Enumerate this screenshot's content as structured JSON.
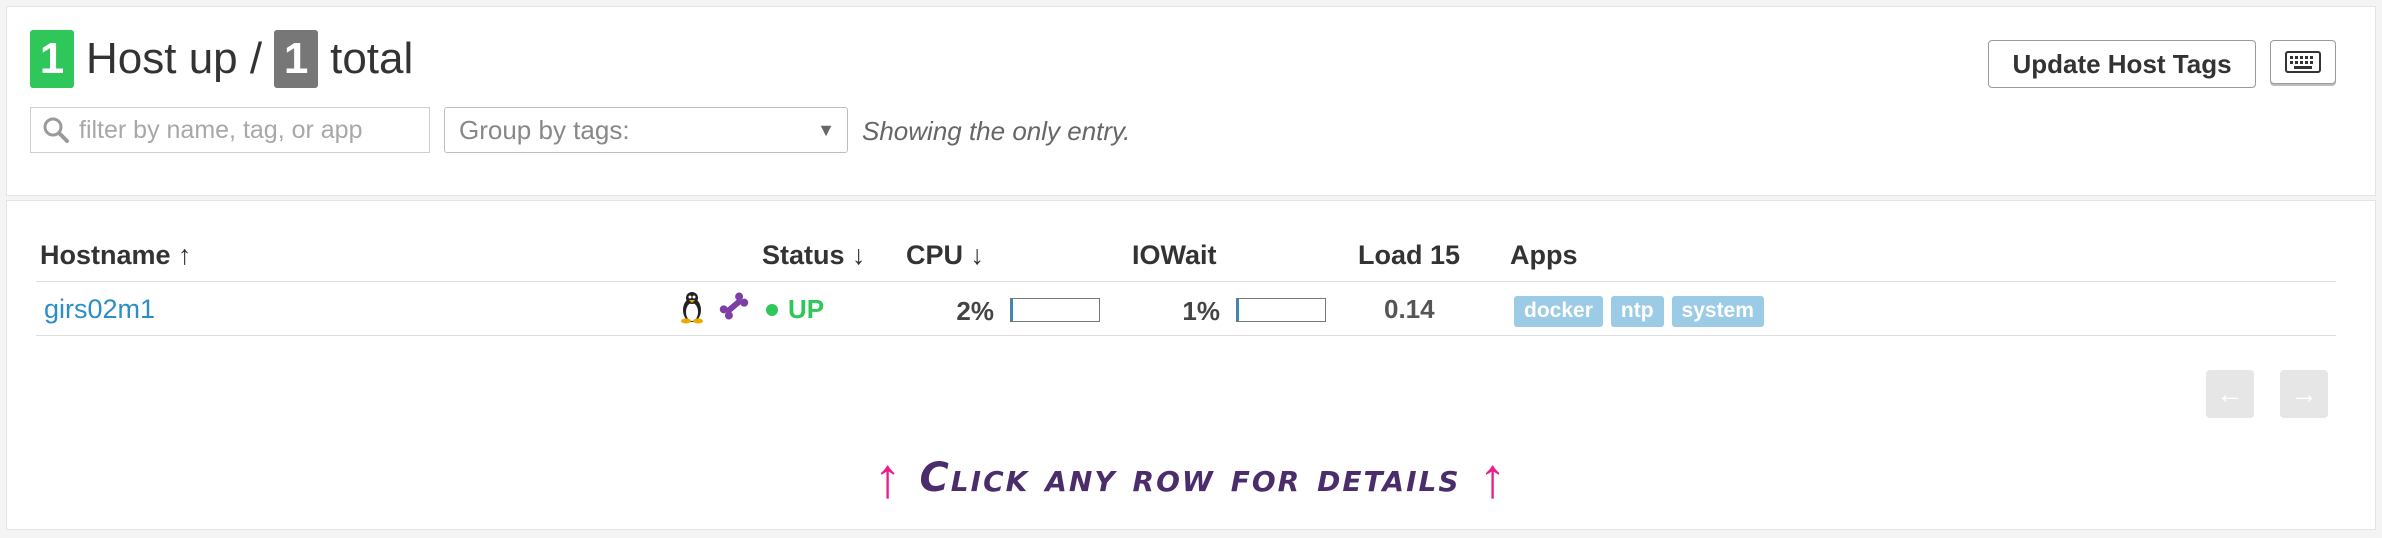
{
  "header": {
    "up_count": "1",
    "up_label": "Host up /",
    "total_count": "1",
    "total_label": "total"
  },
  "controls": {
    "filter_placeholder": "filter by name, tag, or app",
    "group_by_label": "Group by tags:",
    "showing_text": "Showing the only entry.",
    "update_tags_label": "Update Host Tags",
    "keyboard_icon": "keyboard-icon"
  },
  "table": {
    "columns": {
      "hostname": "Hostname ↑",
      "status": "Status ↓",
      "cpu": "CPU ↓",
      "iowait": "IOWait",
      "load15": "Load 15",
      "apps": "Apps"
    },
    "rows": [
      {
        "hostname": "girs02m1",
        "os_icon": "linux-icon",
        "agent_icon": "bone-icon",
        "status": "UP",
        "cpu": "2%",
        "cpu_fraction": 0.02,
        "iowait": "1%",
        "iowait_fraction": 0.01,
        "load15": "0.14",
        "apps": [
          "docker",
          "ntp",
          "system"
        ]
      }
    ]
  },
  "pager": {
    "prev_label": "←",
    "next_label": "→"
  },
  "hint": {
    "text": "Click any row for details",
    "left_arrow": "↑",
    "right_arrow": "↑"
  },
  "colors": {
    "up_green": "#2fc65a",
    "total_gray": "#777777",
    "link_blue": "#2a8fc7",
    "app_tag": "#9ccbe6",
    "hint_arrow": "#e91e8c",
    "hint_text": "#4b2d6b"
  }
}
